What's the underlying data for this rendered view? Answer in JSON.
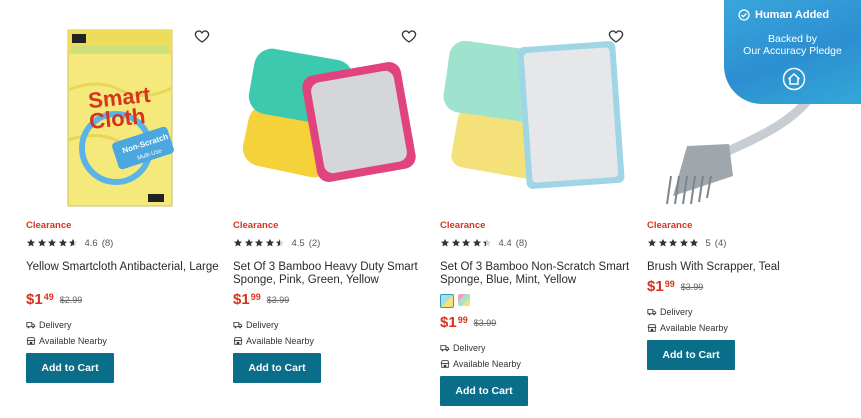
{
  "badge": {
    "title": "Human Added",
    "line1": "Backed by",
    "line2": "Our Accuracy Pledge"
  },
  "products": [
    {
      "clearance": "Clearance",
      "rating": "4.6",
      "reviews": "(8)",
      "stars": 4.6,
      "name": "Yellow Smartcloth Antibacterial, Large",
      "price_dollar": "$",
      "price_main": "1",
      "price_cents": "49",
      "orig_price": "$2.99",
      "delivery": "Delivery",
      "nearby": "Available Nearby",
      "cta": "Add to Cart",
      "brand_top": "Smart",
      "brand_bottom": "Cloth",
      "brand_sub": "Non-Scratch",
      "brand_sub2": "Multi-Use"
    },
    {
      "clearance": "Clearance",
      "rating": "4.5",
      "reviews": "(2)",
      "stars": 4.5,
      "name": "Set Of 3 Bamboo Heavy Duty Smart Sponge, Pink, Green, Yellow",
      "price_dollar": "$",
      "price_main": "1",
      "price_cents": "99",
      "orig_price": "$3.99",
      "delivery": "Delivery",
      "nearby": "Available Nearby",
      "cta": "Add to Cart"
    },
    {
      "clearance": "Clearance",
      "rating": "4.4",
      "reviews": "(8)",
      "stars": 4.4,
      "name": "Set Of 3 Bamboo Non-Scratch Smart Sponge, Blue, Mint, Yellow",
      "price_dollar": "$",
      "price_main": "1",
      "price_cents": "99",
      "orig_price": "$3.99",
      "delivery": "Delivery",
      "nearby": "Available Nearby",
      "cta": "Add to Cart"
    },
    {
      "clearance": "Clearance",
      "rating": "5",
      "reviews": "(4)",
      "stars": 5,
      "name": "Brush With Scrapper, Teal",
      "price_dollar": "$",
      "price_main": "1",
      "price_cents": "99",
      "orig_price": "$3.99",
      "delivery": "Delivery",
      "nearby": "Available Nearby",
      "cta": "Add to Cart"
    }
  ],
  "colors": {
    "clearance": "#d6341f",
    "button": "#0a6e8a",
    "badge": "#2c8fd0"
  },
  "icons": {
    "wishlist": "heart-outline-icon",
    "delivery": "truck-icon",
    "nearby": "store-icon",
    "badge": "check-circle-icon",
    "badge_home": "home-circle-icon"
  }
}
